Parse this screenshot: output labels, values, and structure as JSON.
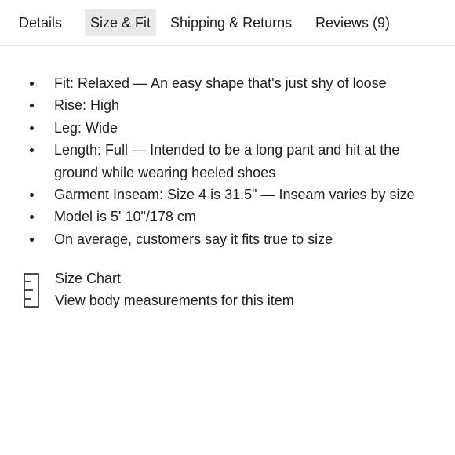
{
  "tabs": [
    {
      "label": "Details",
      "active": false
    },
    {
      "label": "Size & Fit",
      "active": true
    },
    {
      "label": "Shipping & Returns",
      "active": false
    },
    {
      "label": "Reviews (9)",
      "active": false
    }
  ],
  "fit_details": [
    "Fit: Relaxed — An easy shape that's just shy of loose",
    "Rise: High",
    "Leg: Wide",
    "Length: Full — Intended to be a long pant and hit at the ground while wearing heeled shoes",
    "Garment Inseam: Size 4 is 31.5\" — Inseam varies by size",
    "Model is 5' 10\"/178 cm",
    "On average, customers say it fits true to size"
  ],
  "size_chart": {
    "icon": "ruler-icon",
    "link_label": "Size Chart",
    "description": "View body measurements for this item"
  },
  "colors": {
    "text": "#1f1f1f",
    "active_tab_bg": "#e9e9e9",
    "divider": "#e3e3e3"
  }
}
